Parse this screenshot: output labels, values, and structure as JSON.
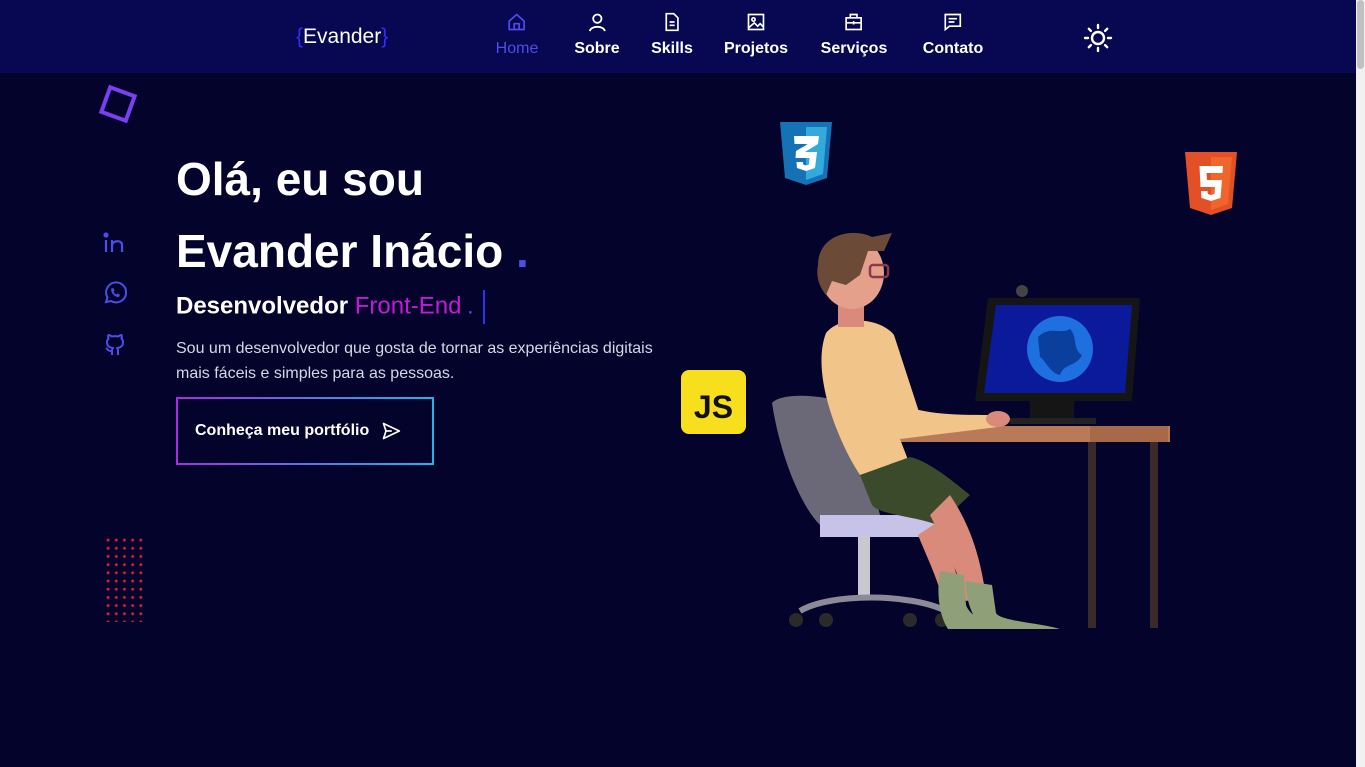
{
  "header": {
    "logo_open": "{",
    "logo_text": "Evander",
    "logo_close": "}",
    "nav": [
      {
        "label": "Home",
        "icon": "home-icon",
        "active": true
      },
      {
        "label": "Sobre",
        "icon": "user-icon",
        "active": false
      },
      {
        "label": "Skills",
        "icon": "document-icon",
        "active": false
      },
      {
        "label": "Projetos",
        "icon": "image-icon",
        "active": false
      },
      {
        "label": "Serviços",
        "icon": "briefcase-icon",
        "active": false
      },
      {
        "label": "Contato",
        "icon": "message-icon",
        "active": false
      }
    ],
    "theme_icon": "sun-icon"
  },
  "social": [
    {
      "name": "linkedin",
      "icon": "linkedin-icon"
    },
    {
      "name": "whatsapp",
      "icon": "whatsapp-icon"
    },
    {
      "name": "github",
      "icon": "github-icon"
    }
  ],
  "hero": {
    "greeting": "Olá, eu sou",
    "name": "Evander Inácio",
    "name_dot": ".",
    "role_prefix": "Desenvolvedor",
    "role_accent": "Front-End",
    "role_dot": ".",
    "description": "Sou um desenvolvedor que gosta de tornar as experiências digitais mais fáceis e simples para as pessoas.",
    "cta_label": "Conheça meu portfólio",
    "cta_icon": "send-icon"
  },
  "badges": {
    "js": "JS",
    "css": "css3-icon",
    "html": "html5-icon"
  },
  "colors": {
    "background": "#04032b",
    "header": "#080752",
    "primary": "#4d4dea",
    "accent": "#c21bd6",
    "brace": "#2f2ff5"
  }
}
